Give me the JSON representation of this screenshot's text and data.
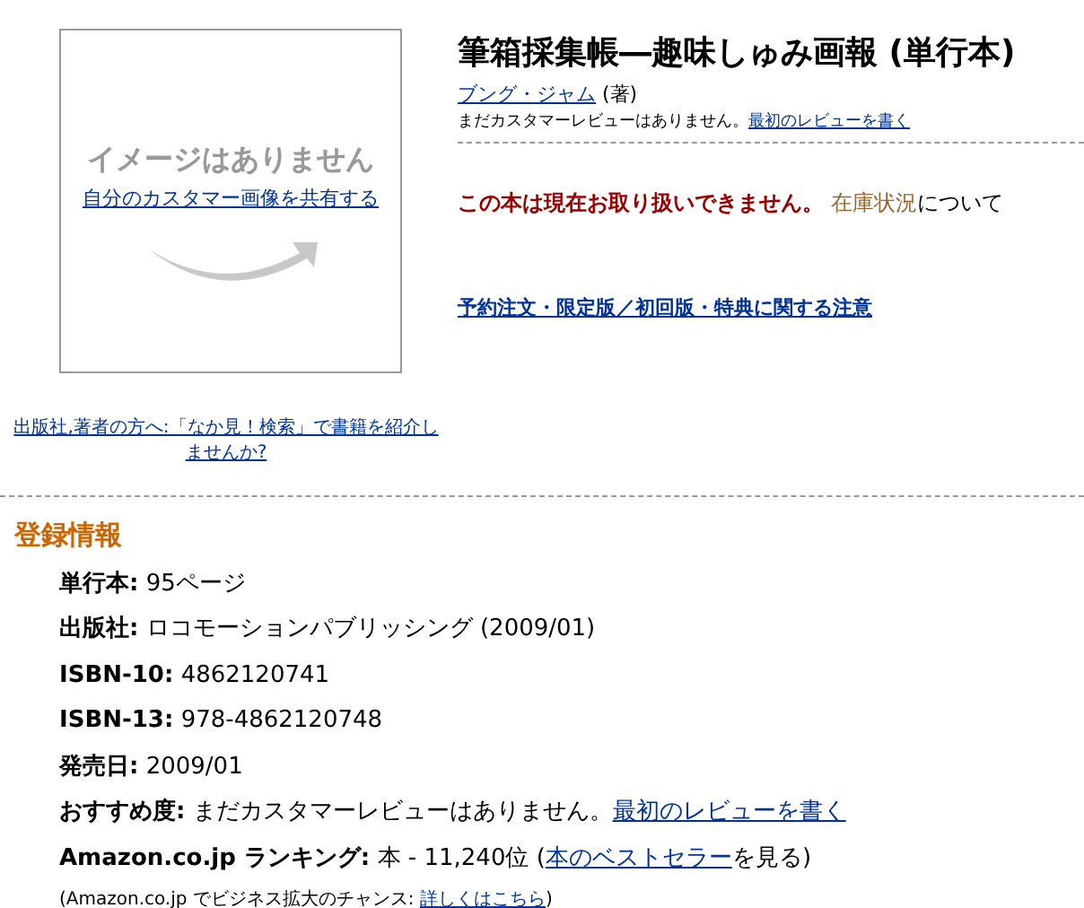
{
  "image_box": {
    "no_image": "イメージはありません",
    "share_link": "自分のカスタマー画像を共有する"
  },
  "publisher_link": "出版社,著者の方へ:「なか見！検索」で書籍を紹介しませんか?",
  "product": {
    "title": "筆箱採集帳―趣味しゅみ画報 (単行本)",
    "author": "ブング・ジャム",
    "author_role": "(著)",
    "review_text": "まだカスタマーレビューはありません。",
    "review_link": "最初のレビューを書く"
  },
  "availability": {
    "message": "この本は現在お取り扱いできません。",
    "stock_link": "在庫状況",
    "stock_after": "について"
  },
  "preorder_link": "予約注文・限定版／初回版・特典に関する注意",
  "details": {
    "heading": "登録情報",
    "rows": [
      {
        "label": "単行本:",
        "text": "95ページ"
      },
      {
        "label": "出版社:",
        "text": "ロコモーションパブリッシング (2009/01)"
      },
      {
        "label": "ISBN-10:",
        "text": "4862120741"
      },
      {
        "label": "ISBN-13:",
        "text": "978-4862120748"
      },
      {
        "label": "発売日:",
        "text": "2009/01"
      },
      {
        "label": "おすすめ度:",
        "text": "まだカスタマーレビューはありません。",
        "link": "最初のレビューを書く"
      },
      {
        "label": "Amazon.co.jp ランキング:",
        "text": "本 - 11,240位 (",
        "link": "本のベストセラー",
        "after": "を見る)"
      }
    ],
    "note": {
      "text": "(Amazon.co.jp でビジネス拡大のチャンス: ",
      "link": "詳しくはこちら",
      "after": ")"
    }
  }
}
